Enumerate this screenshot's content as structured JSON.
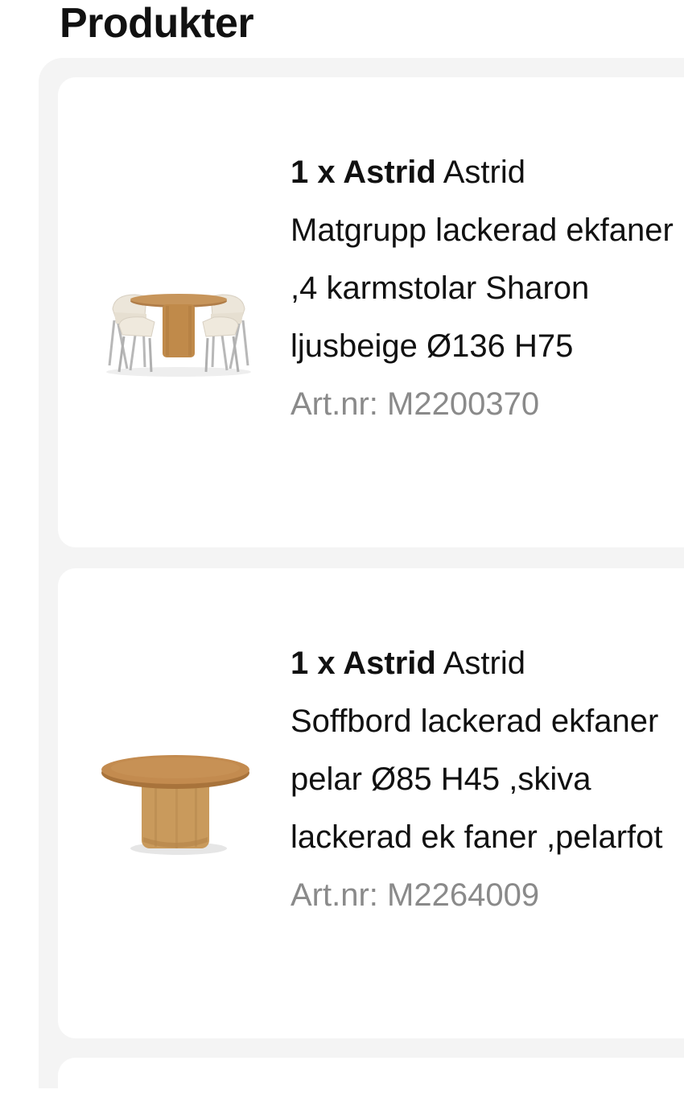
{
  "page": {
    "title": "Produkter"
  },
  "products": [
    {
      "qty_name": "1 x Astrid",
      "brand": "Astrid",
      "description": "Matgrupp lackerad ekfaner ,4 karmstolar Sharon ljusbeige Ø136 H75",
      "article_number": "Art.nr: M2200370",
      "image": "dining-set-image"
    },
    {
      "qty_name": "1 x Astrid",
      "brand": "Astrid",
      "description": "Soffbord lackerad ekfaner pelar Ø85 H45 ,skiva lackerad ek faner ,pelarfot",
      "article_number": "Art.nr: M2264009",
      "image": "coffee-table-image"
    }
  ],
  "colors": {
    "panel_bg": "#f4f4f4",
    "card_bg": "#ffffff",
    "text": "#111111",
    "muted": "#8a8a8a",
    "oak": "#c08a4a"
  }
}
